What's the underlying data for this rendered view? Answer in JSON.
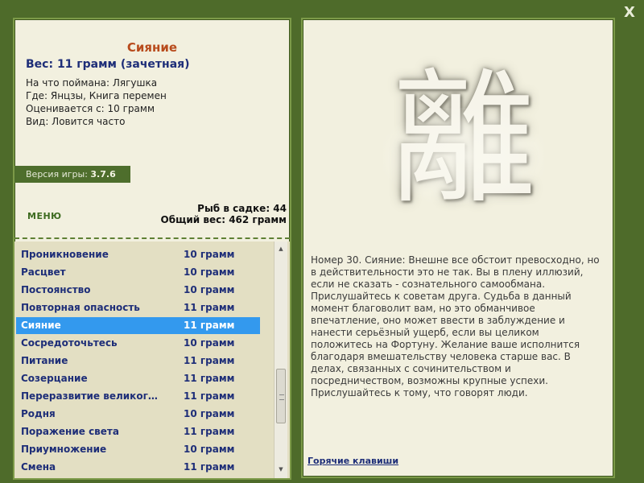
{
  "window": {
    "close_glyph": "X"
  },
  "fish": {
    "title": "Сияние",
    "weight_line": "Вес: 11 грамм (зачетная)",
    "info": [
      "На что поймана: Лягушка",
      "Где: Янцзы, Книга перемен",
      "Оценивается с: 10 грамм",
      "Вид: Ловится часто"
    ]
  },
  "version": {
    "label": "Версия игры: ",
    "number": "3.7.6"
  },
  "menu": {
    "label": "МЕНЮ"
  },
  "stats": {
    "fish_in_cage": "Рыб в садке: 44",
    "total_weight": "Общий вес: 462 грамм"
  },
  "fish_list": {
    "rows": [
      {
        "name": "Проникновение",
        "weight": "10 грамм"
      },
      {
        "name": "Расцвет",
        "weight": "10 грамм"
      },
      {
        "name": "Постоянство",
        "weight": "10 грамм"
      },
      {
        "name": "Повторная опасность",
        "weight": "11 грамм"
      },
      {
        "name": "Сияние",
        "weight": "11 грамм"
      },
      {
        "name": "Сосредоточьтесь",
        "weight": "10 грамм"
      },
      {
        "name": "Питание",
        "weight": "11 грамм"
      },
      {
        "name": "Созерцание",
        "weight": "11 грамм"
      },
      {
        "name": "Переразвитие великог…",
        "weight": "11 грамм"
      },
      {
        "name": "Родня",
        "weight": "10 грамм"
      },
      {
        "name": "Поражение света",
        "weight": "11 грамм"
      },
      {
        "name": "Приумножение",
        "weight": "10 грамм"
      },
      {
        "name": "Смена",
        "weight": "11 грамм"
      }
    ],
    "selected_index": 4
  },
  "hexagram": {
    "glyph": "離"
  },
  "reading": {
    "text": "Номер 30. Сияние: Внешне все обстоит превосходно, но в действительности это не так. Вы в плену иллюзий, если не сказать - сознательного самообмана. Прислушайтесь к советам друга. Судьба в данный момент благоволит вам, но это обманчивое впечатление, оно может ввести в заблуждение и нанести серьёзный ущерб, если вы целиком положитесь на Фортуну. Желание ваше исполнится благодаря вмешательству человека старше вас. В делах, связанных с сочинительством и посредничеством, возможны крупные успехи. Прислушайтесь к тому, что говорят люди."
  },
  "hotkeys": {
    "label": "Горячие клавиши"
  },
  "colors": {
    "background": "#4e6b2a",
    "panel": "#f2f0df",
    "list_bg": "#e3dfc3",
    "title_orange": "#b84b1c",
    "text_navy": "#1e2e78",
    "selection": "#3399ee"
  }
}
